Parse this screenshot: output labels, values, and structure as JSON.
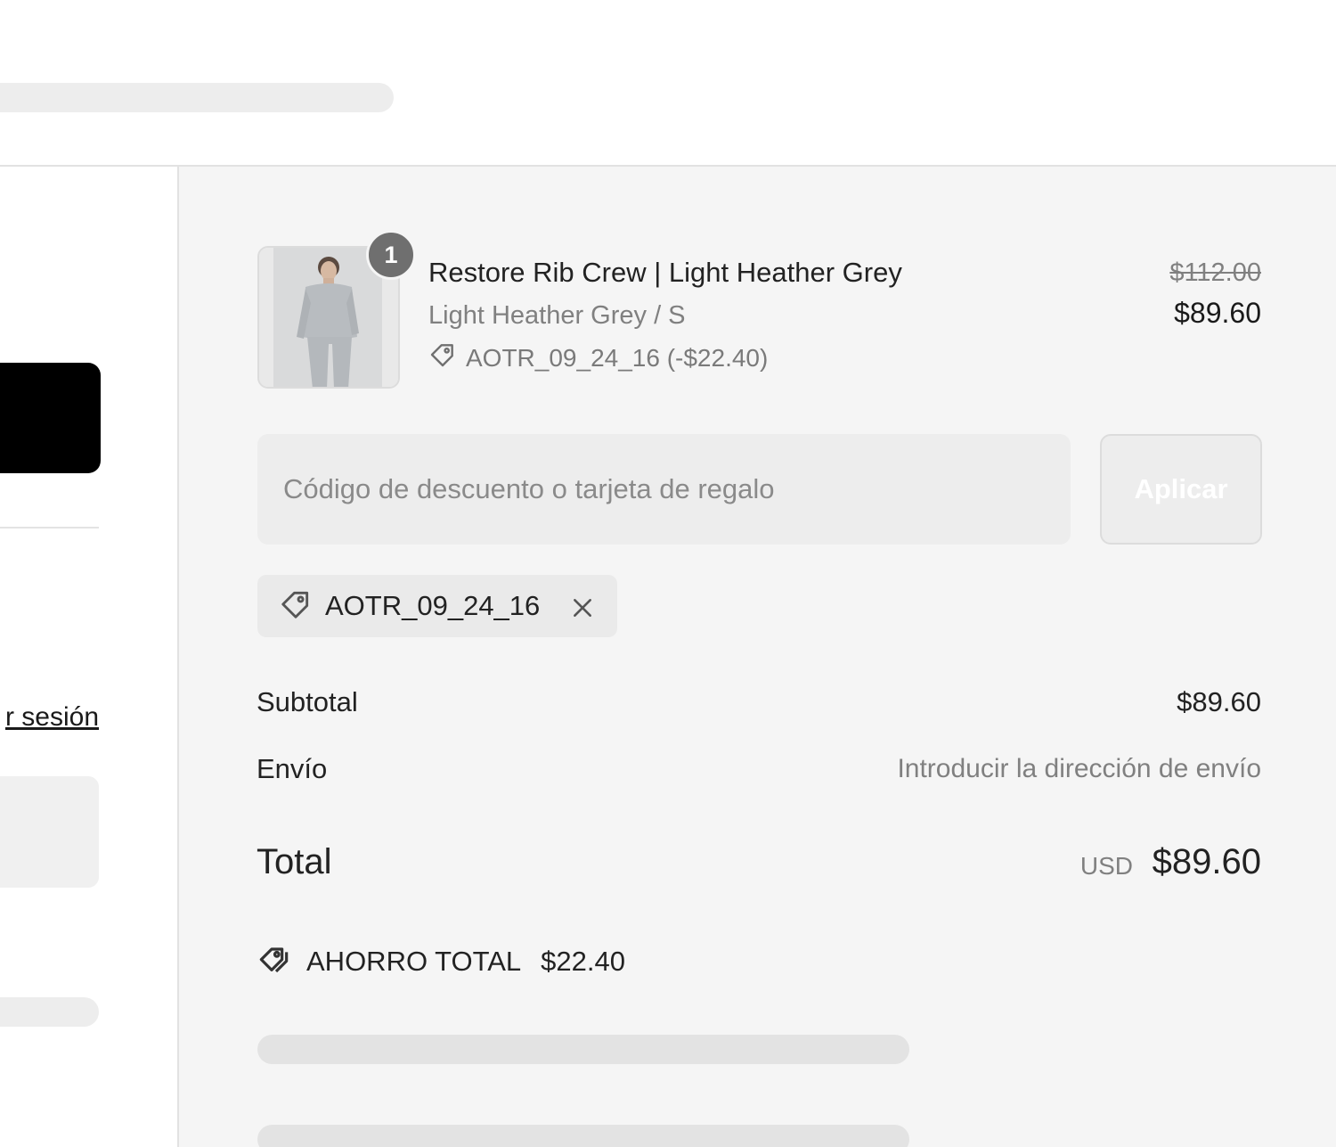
{
  "left": {
    "login_link": "r sesión"
  },
  "cart_item": {
    "quantity": "1",
    "name": "Restore Rib Crew | Light Heather Grey",
    "variant": "Light Heather Grey / S",
    "discount_line": "AOTR_09_24_16 (-$22.40)",
    "price_original": "$112.00",
    "price_final": "$89.60"
  },
  "discount": {
    "placeholder": "Código de descuento o tarjeta de regalo",
    "apply_label": "Aplicar",
    "applied_code": "AOTR_09_24_16"
  },
  "summary": {
    "subtotal_label": "Subtotal",
    "subtotal_value": "$89.60",
    "shipping_label": "Envío",
    "shipping_value": "Introducir la dirección de envío",
    "total_label": "Total",
    "total_currency": "USD",
    "total_value": "$89.60",
    "savings_label": "AHORRO TOTAL",
    "savings_value": "$22.40"
  },
  "colors": {
    "panel_bg": "#f5f5f5",
    "primary_button": "#000000",
    "muted_text": "#808080"
  },
  "icons": [
    "tag-icon",
    "close-icon",
    "savings-tag-icon"
  ]
}
